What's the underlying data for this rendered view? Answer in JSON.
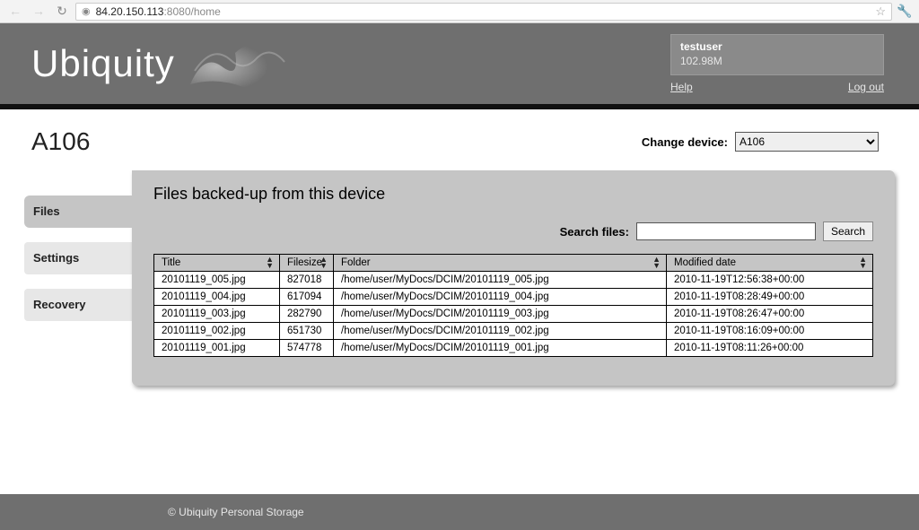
{
  "browser": {
    "url_host": "84.20.150.113",
    "url_port": ":8080",
    "url_path": "/home"
  },
  "header": {
    "logo_text": "Ubiquity",
    "username": "testuser",
    "quota": "102.98M",
    "help_label": "Help",
    "logout_label": "Log out"
  },
  "page": {
    "device_title": "A106",
    "change_device_label": "Change device:",
    "device_options": [
      "A106"
    ],
    "panel_title": "Files backed-up from this device",
    "search_label": "Search files:",
    "search_value": "",
    "search_button": "Search"
  },
  "tabs": {
    "files": "Files",
    "settings": "Settings",
    "recovery": "Recovery"
  },
  "table": {
    "columns": {
      "title": "Title",
      "filesize": "Filesize",
      "folder": "Folder",
      "modified": "Modified date"
    },
    "rows": [
      {
        "title": "20101119_005.jpg",
        "filesize": "827018",
        "folder": "/home/user/MyDocs/DCIM/20101119_005.jpg",
        "modified": "2010-11-19T12:56:38+00:00"
      },
      {
        "title": "20101119_004.jpg",
        "filesize": "617094",
        "folder": "/home/user/MyDocs/DCIM/20101119_004.jpg",
        "modified": "2010-11-19T08:28:49+00:00"
      },
      {
        "title": "20101119_003.jpg",
        "filesize": "282790",
        "folder": "/home/user/MyDocs/DCIM/20101119_003.jpg",
        "modified": "2010-11-19T08:26:47+00:00"
      },
      {
        "title": "20101119_002.jpg",
        "filesize": "651730",
        "folder": "/home/user/MyDocs/DCIM/20101119_002.jpg",
        "modified": "2010-11-19T08:16:09+00:00"
      },
      {
        "title": "20101119_001.jpg",
        "filesize": "574778",
        "folder": "/home/user/MyDocs/DCIM/20101119_001.jpg",
        "modified": "2010-11-19T08:11:26+00:00"
      }
    ]
  },
  "footer": {
    "copyright": "© Ubiquity Personal Storage"
  }
}
